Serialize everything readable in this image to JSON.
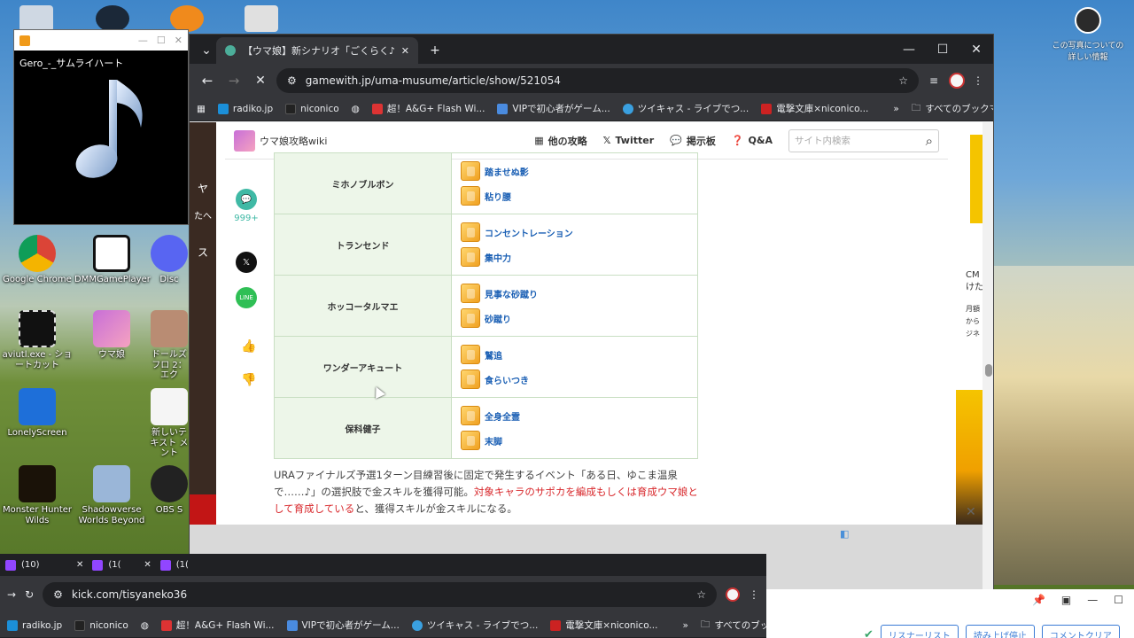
{
  "desktop": {
    "icons": [
      {
        "label": "Google Chrome"
      },
      {
        "label": "DMMGamePlayer"
      },
      {
        "label": "Disc"
      },
      {
        "label": "aviutl.exe - ショートカット"
      },
      {
        "label": "ウマ娘"
      },
      {
        "label": "ドールズフロ 2：エク"
      },
      {
        "label": "LonelyScreen"
      },
      {
        "label": "新しいテキスト メント"
      },
      {
        "label": "Monster Hunter Wilds"
      },
      {
        "label": "Shadowverse Worlds Beyond"
      },
      {
        "label": "OBS S"
      }
    ],
    "photo_info": "この写真についての詳しい情報"
  },
  "player": {
    "title": "Gero_-_サムライハート"
  },
  "browser": {
    "tab_title": "【ウマ娘】新シナリオ「ごくらく♪ゆこま",
    "url": "gamewith.jp/uma-musume/article/show/521054",
    "bookmarks": [
      "radiko.jp",
      "niconico",
      "超！A&G+ Flash Wi...",
      "VIPで初心者がゲーム...",
      "ツイキャス - ライブでつ...",
      "電撃文庫×niconico..."
    ],
    "bookmarks_folder": "すべてのブックマーク"
  },
  "site": {
    "logo_text": "ウマ娘攻略wiki",
    "nav": [
      "他の攻略",
      "Twitter",
      "掲示板",
      "Q&A"
    ],
    "search_placeholder": "サイト内検索",
    "comment_count": "999+",
    "side_texts": [
      "ヤ",
      "たへ",
      "ス"
    ],
    "rows": [
      {
        "name": "ミホノブルボン",
        "skills": [
          "踏ませぬ影",
          "粘り腰"
        ]
      },
      {
        "name": "トランセンド",
        "skills": [
          "コンセントレーション",
          "集中力"
        ]
      },
      {
        "name": "ホッコータルマエ",
        "skills": [
          "見事な砂蹴り",
          "砂蹴り"
        ]
      },
      {
        "name": "ワンダーアキュート",
        "skills": [
          "鷲追",
          "食らいつき"
        ]
      },
      {
        "name": "保科健子",
        "skills": [
          "全身全霊",
          "末脚"
        ]
      }
    ],
    "para_normal_1": "URAファイナルズ予選1ターン目練習後に固定で発生するイベント「ある日、ゆこま温泉で……♪」の選択肢で金スキルを獲得可能。",
    "para_red": "対象キャラのサポカを編成もしくは育成ウマ娘として育成している",
    "para_normal_2": "と、獲得スキルが金スキルになる。",
    "ad_texts": [
      "CM",
      "けた",
      "月額",
      "から",
      "ジネ"
    ]
  },
  "bottom_browser": {
    "tabs": [
      "(10)",
      "(1(",
      "(1("
    ],
    "url": "kick.com/tisyaneko36",
    "bookmarks": [
      "radiko.jp",
      "niconico",
      "超！A&G+ Flash Wi...",
      "VIPで初心者がゲーム...",
      "ツイキャス - ライブでつ...",
      "電撃文庫×niconico..."
    ],
    "bookmarks_folder": "すべてのブックマーク"
  },
  "bottom_right": {
    "buttons": [
      "リスナーリスト",
      "読み上げ停止",
      "コメントクリア"
    ]
  }
}
